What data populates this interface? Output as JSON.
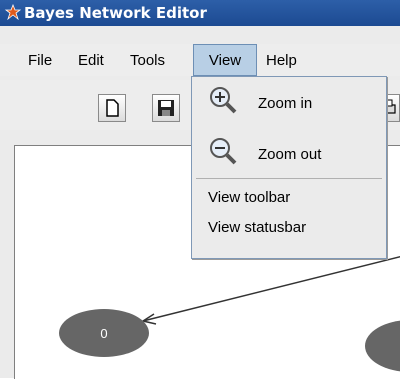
{
  "window": {
    "title": "Bayes Network Editor"
  },
  "menubar": {
    "items": [
      {
        "label": "File"
      },
      {
        "label": "Edit"
      },
      {
        "label": "Tools"
      },
      {
        "label": "View"
      },
      {
        "label": "Help"
      }
    ]
  },
  "view_menu": {
    "items": [
      {
        "label": "Zoom in",
        "icon": "zoom-in-icon"
      },
      {
        "label": "Zoom out",
        "icon": "zoom-out-icon"
      },
      {
        "label": "View toolbar"
      },
      {
        "label": "View statusbar"
      }
    ]
  },
  "network": {
    "nodes": [
      {
        "label": "0"
      }
    ]
  },
  "colors": {
    "titlebar": "#2d5fa8",
    "menu_active": "#b8cfe5",
    "node_fill": "#666666"
  }
}
